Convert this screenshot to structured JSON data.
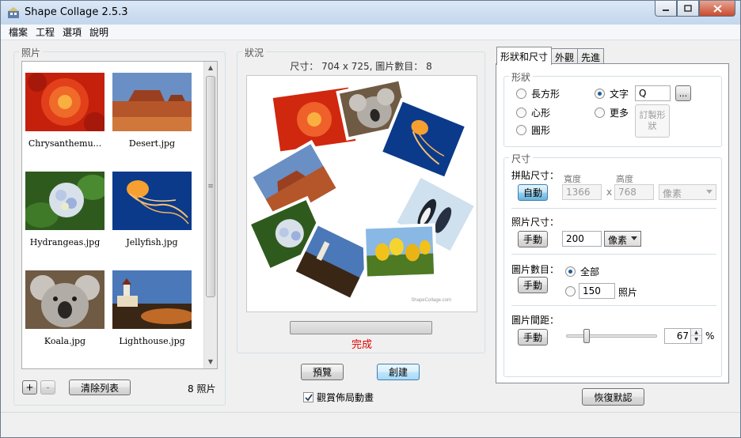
{
  "window": {
    "title": "Shape Collage 2.5.3"
  },
  "menu": [
    "檔案",
    "工程",
    "選項",
    "說明"
  ],
  "photos_panel": {
    "title": "照片",
    "photos": [
      {
        "label": "Chrysanthemu..."
      },
      {
        "label": "Desert.jpg"
      },
      {
        "label": "Hydrangeas.jpg"
      },
      {
        "label": "Jellyfish.jpg"
      },
      {
        "label": "Koala.jpg"
      },
      {
        "label": "Lighthouse.jpg"
      }
    ],
    "add_label": "+",
    "remove_label": "-",
    "clear_label": "清除列表",
    "count_label": "8 照片"
  },
  "status_panel": {
    "title": "狀況",
    "size_info": "尺寸： 704 x 725, 圖片數目： 8",
    "watermark": "ShapeCollage.com",
    "progress": 0,
    "status_text": "完成",
    "preview_label": "預覽",
    "create_label": "創建",
    "animate_checked": true,
    "animate_label": "觀賞佈局動畫"
  },
  "tabs": [
    "形狀和尺寸",
    "外觀",
    "先進"
  ],
  "shape_group": {
    "title": "形狀",
    "options": {
      "rect": "長方形",
      "heart": "心形",
      "circle": "圓形",
      "text": "文字",
      "more": "更多"
    },
    "selected": "text",
    "text_value": "Q",
    "ellipsis_label": "...",
    "custom_shape_label": "訂製形狀"
  },
  "size_group": {
    "title": "尺寸",
    "canvas_size_label": "拼貼尺寸：",
    "auto_label": "自動",
    "width_label": "寬度",
    "height_label": "高度",
    "width_value": "1366",
    "height_value": "768",
    "x_label": "x",
    "unit_value": "像素",
    "photo_size_label": "照片尺寸：",
    "manual_label": "手動",
    "photo_size_value": "200",
    "photo_unit_value": "像素",
    "num_photos_label": "圖片數目：",
    "all_label": "全部",
    "num_value": "150",
    "photos_unit": "照片",
    "spacing_label": "圖片間距：",
    "spacing_value": "67",
    "percent": "%",
    "spacing_slider": 0.2
  },
  "restore_label": "恢復默認",
  "colors": {
    "status_red": "#e00000",
    "accent_blue": "#3c7fb1"
  }
}
